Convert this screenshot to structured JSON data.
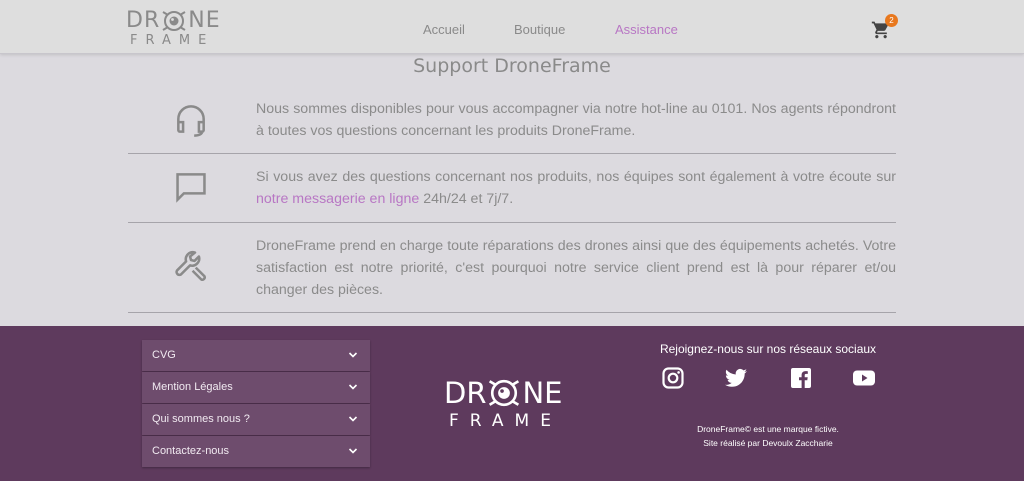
{
  "header": {
    "logo_line1_left": "DR",
    "logo_line1_right": "NE",
    "logo_line2": "FRAME",
    "nav": [
      {
        "label": "Accueil",
        "active": false
      },
      {
        "label": "Boutique",
        "active": false
      },
      {
        "label": "Assistance",
        "active": true
      }
    ],
    "cart_icon": "shopping-cart-icon",
    "cart_count": "2"
  },
  "support": {
    "title": "Support DroneFrame",
    "rows": [
      {
        "icon": "headset-icon",
        "text": "Nous sommes disponibles pour vous accompagner via notre hot-line au 0101. Nos agents répondront à toutes vos questions concernant les produits DroneFrame."
      },
      {
        "icon": "chat-bubble-icon",
        "text_before": "Si vous avez des questions concernant nos produits, nos équipes sont également à votre écoute sur",
        "link": "notre messagerie en ligne",
        "text_after": "24h/24 et 7j/7."
      },
      {
        "icon": "wrench-icon",
        "text": "DroneFrame prend en charge toute réparations des drones ainsi que des équipements achetés. Votre satisfaction est notre priorité, c'est pourquoi notre service client prend est là pour réparer et/ou changer des pièces."
      }
    ]
  },
  "footer": {
    "accordion": [
      {
        "label": "CVG"
      },
      {
        "label": "Mention Légales"
      },
      {
        "label": "Qui sommes nous ?"
      },
      {
        "label": "Contactez-nous"
      }
    ],
    "logo_line1_left": "DR",
    "logo_line1_right": "NE",
    "logo_line2": "FRAME",
    "social_title": "Rejoignez-nous sur nos réseaux sociaux",
    "social_icons": [
      "instagram-icon",
      "twitter-icon",
      "facebook-icon",
      "youtube-icon"
    ],
    "legal_line1": "DroneFrame© est une marque fictive.",
    "legal_line2": "Site réalisé par Devoulx Zaccharie"
  },
  "colors": {
    "accent": "#b877c4",
    "footer_bg": "#5e3a5d",
    "badge": "#e8781e",
    "body_bg": "#dcdadf"
  }
}
